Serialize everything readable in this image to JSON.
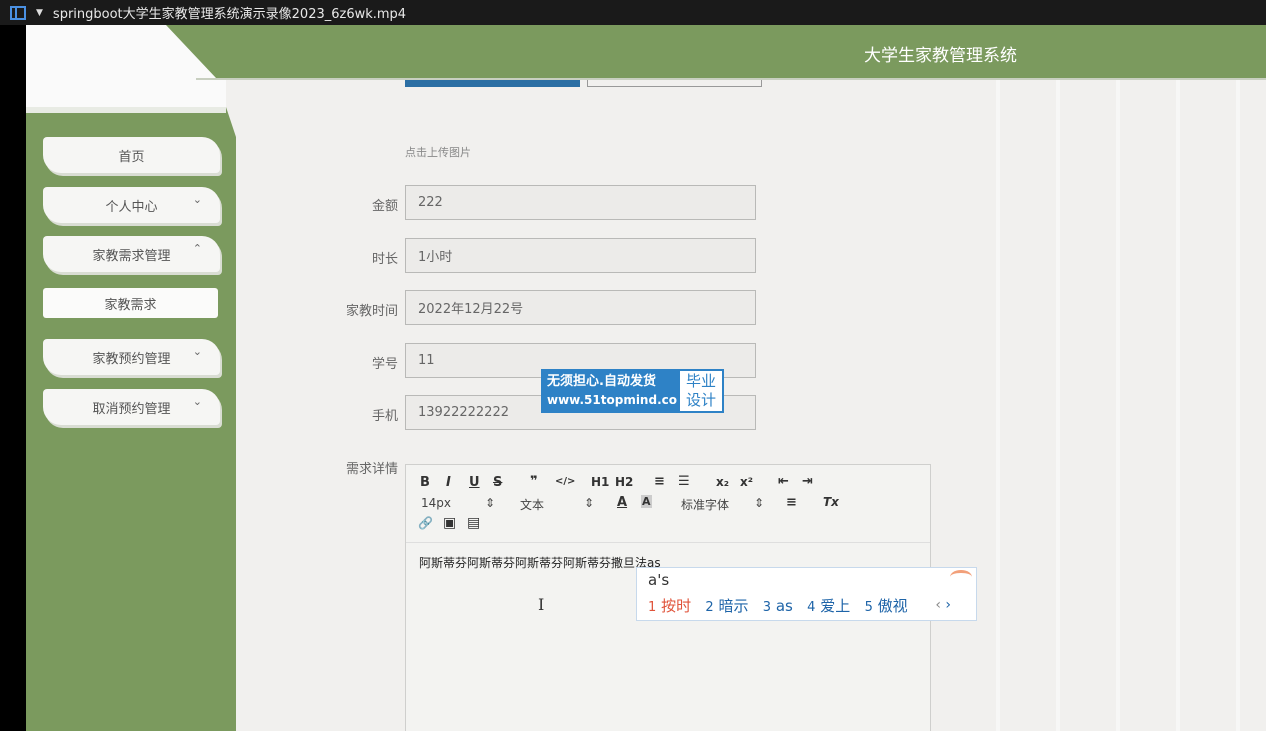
{
  "window": {
    "title": "springboot大学生家教管理系统演示录像2023_6z6wk.mp4"
  },
  "header": {
    "system_title": "大学生家教管理系统"
  },
  "sidebar": {
    "items": [
      {
        "label": "首页"
      },
      {
        "label": "个人中心",
        "chevron": "⌄"
      },
      {
        "label": "家教需求管理",
        "chevron": "⌃"
      },
      {
        "label": "家教需求"
      },
      {
        "label": "家教预约管理",
        "chevron": "⌄"
      },
      {
        "label": "取消预约管理",
        "chevron": "⌄"
      }
    ]
  },
  "form": {
    "upload_hint": "点击上传图片",
    "fields": [
      {
        "label": "金额",
        "value": "222"
      },
      {
        "label": "时长",
        "value": "1小时"
      },
      {
        "label": "家教时间",
        "value": "2022年12月22号"
      },
      {
        "label": "学号",
        "value": "11"
      },
      {
        "label": "手机",
        "value": "13922222222"
      }
    ],
    "detail_label": "需求详情"
  },
  "editor": {
    "toolbar": {
      "bold": "B",
      "italic": "I",
      "underline": "U",
      "strike": "S",
      "quote": "❞",
      "code": "</>",
      "h1": "H1",
      "h2": "H2",
      "ordered_list": "≡",
      "bullet_list": "☰",
      "subscript": "x₂",
      "superscript": "x²",
      "outdent": "⇤",
      "indent": "⇥",
      "font_size": "14px",
      "text_style": "文本",
      "font_color": "A",
      "bg_color": "A",
      "font_family": "标准字体",
      "align": "≡",
      "clear_format": "Tx",
      "link": "🔗",
      "image": "▣",
      "video": "▤"
    },
    "content": "阿斯蒂芬阿斯蒂芬阿斯蒂芬阿斯蒂芬撒旦法as"
  },
  "ime": {
    "composition": "a's",
    "candidates": [
      {
        "num": "1",
        "text": "按时"
      },
      {
        "num": "2",
        "text": "暗示"
      },
      {
        "num": "3",
        "text": "as"
      },
      {
        "num": "4",
        "text": "爱上"
      },
      {
        "num": "5",
        "text": "傲视"
      }
    ],
    "prev": "‹",
    "next": "›"
  },
  "watermark": {
    "line1": "无须担心.自动发货",
    "line2": "www.51topmind.com",
    "badge_line1": "毕业",
    "badge_line2": "设计"
  }
}
